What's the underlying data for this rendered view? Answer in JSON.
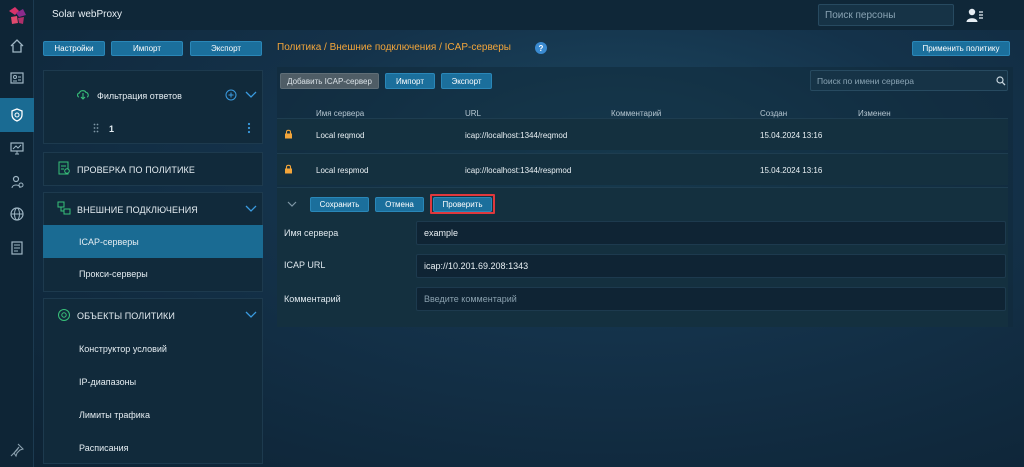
{
  "app": {
    "title": "Solar webProxy"
  },
  "top": {
    "person_search_placeholder": "Поиск персоны"
  },
  "toolbar": {
    "settings": "Настройки",
    "import": "Импорт",
    "export": "Экспорт",
    "apply_policy": "Применить политику"
  },
  "breadcrumb": "Политика / Внешние подключения / ICAP-серверы",
  "help": "?",
  "left": {
    "filter_item": "Фильтрация ответов",
    "filter_sub": "1",
    "policy_check": "ПРОВЕРКА ПО ПОЛИТИКЕ",
    "external": "ВНЕШНИЕ ПОДКЛЮЧЕНИЯ",
    "external_items": [
      "ICAP-серверы",
      "Прокси-серверы"
    ],
    "objects": "ОБЪЕКТЫ ПОЛИТИКИ",
    "object_items": [
      "Конструктор условий",
      "IP-диапазоны",
      "Лимиты трафика",
      "Расписания"
    ]
  },
  "content_toolbar": {
    "add": "Добавить ICAP-сервер",
    "import": "Импорт",
    "export": "Экспорт",
    "search_placeholder": "Поиск по имени сервера"
  },
  "table": {
    "columns": [
      "Имя сервера",
      "URL",
      "Комментарий",
      "Создан",
      "Изменен"
    ],
    "rows": [
      {
        "name": "Local reqmod",
        "url": "icap://localhost:1344/reqmod",
        "comment": "",
        "created": "15.04.2024 13:16",
        "modified": ""
      },
      {
        "name": "Local respmod",
        "url": "icap://localhost:1344/respmod",
        "comment": "",
        "created": "15.04.2024 13:16",
        "modified": ""
      }
    ]
  },
  "edit": {
    "save": "Сохранить",
    "cancel": "Отмена",
    "check": "Проверить",
    "name_label": "Имя сервера",
    "name_value": "example",
    "url_label": "ICAP URL",
    "url_value": "icap://10.201.69.208:1343",
    "comment_label": "Комментарий",
    "comment_placeholder": "Введите комментарий"
  },
  "colors": {
    "accent": "#1b6f9c",
    "selected": "#1a6b93",
    "breadcrumb": "#f3a53a",
    "highlight": "#e0383d"
  }
}
